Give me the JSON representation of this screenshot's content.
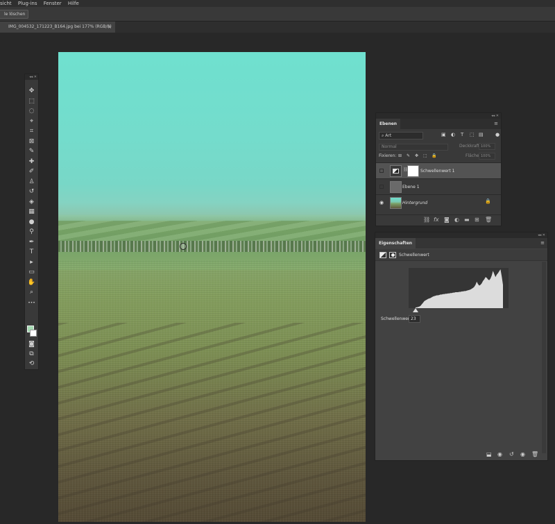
{
  "menubar": {
    "items": [
      "sicht",
      "Plug-ins",
      "Fenster",
      "Hilfe"
    ]
  },
  "options": {
    "clear_button": "le löschen"
  },
  "document": {
    "tab_title": "IMG_004532_171223_B164.jpg bei 177% (RGB/8)",
    "close_glyph": "×"
  },
  "toolbar": {
    "collapse": "◂◂ ✕",
    "tools": [
      {
        "name": "move-tool",
        "glyph": "✥"
      },
      {
        "name": "marquee-tool",
        "glyph": "⬚"
      },
      {
        "name": "lasso-tool",
        "glyph": "◌"
      },
      {
        "name": "quick-select-tool",
        "glyph": "⌖"
      },
      {
        "name": "crop-tool",
        "glyph": "⌗"
      },
      {
        "name": "frame-tool",
        "glyph": "⊠"
      },
      {
        "name": "eyedropper-tool",
        "glyph": "✎"
      },
      {
        "name": "healing-brush-tool",
        "glyph": "✚"
      },
      {
        "name": "brush-tool",
        "glyph": "✐"
      },
      {
        "name": "clone-stamp-tool",
        "glyph": "♙"
      },
      {
        "name": "history-brush-tool",
        "glyph": "↺"
      },
      {
        "name": "eraser-tool",
        "glyph": "◈"
      },
      {
        "name": "gradient-tool",
        "glyph": "▦"
      },
      {
        "name": "blur-tool",
        "glyph": "●"
      },
      {
        "name": "dodge-tool",
        "glyph": "⚲"
      },
      {
        "name": "pen-tool",
        "glyph": "✒"
      },
      {
        "name": "type-tool",
        "glyph": "T"
      },
      {
        "name": "path-select-tool",
        "glyph": "▸"
      },
      {
        "name": "shape-tool",
        "glyph": "▭"
      },
      {
        "name": "hand-tool",
        "glyph": "✋"
      },
      {
        "name": "zoom-tool",
        "glyph": "⌕"
      },
      {
        "name": "more-tools",
        "glyph": "•••"
      }
    ],
    "bottom_tools": [
      {
        "name": "quick-mask-icon",
        "glyph": "◙"
      },
      {
        "name": "screen-mode-icon",
        "glyph": "⧉"
      },
      {
        "name": "share-icon",
        "glyph": "⟲"
      }
    ],
    "foreground_color": "#a6dcb4",
    "background_color": "#ffffff"
  },
  "layers_panel": {
    "collapse": "◂◂ ✕",
    "tab": "Ebenen",
    "menu_glyph": "≡",
    "kind_filter": "Art",
    "blend_mode": "Normal",
    "opacity_label": "Deckkraft:",
    "opacity_value": "100%",
    "lock_label": "Fixieren:",
    "fill_label": "Fläche:",
    "fill_value": "100%",
    "layers": [
      {
        "name": "Schwellenwert 1",
        "visible": false,
        "selected": true
      },
      {
        "name": "Ebene 1",
        "visible": false,
        "selected": false
      },
      {
        "name": "Hintergrund",
        "visible": true,
        "selected": false,
        "locked": true
      }
    ],
    "eye_glyph": "👁",
    "lock_glyph": "🔒"
  },
  "properties_panel": {
    "collapse": "◂◂ ✕",
    "tab": "Eigenschaften",
    "menu_glyph": "≡",
    "adjustment_name": "Schwellenwert",
    "threshold_label": "Schwellenwert:",
    "threshold_value": "23",
    "histogram": [
      2,
      2,
      3,
      4,
      6,
      10,
      14,
      18,
      20,
      22,
      24,
      25,
      26,
      28,
      30,
      31,
      32,
      33,
      33,
      34,
      35,
      35,
      36,
      36,
      37,
      37,
      38,
      38,
      39,
      39,
      40,
      40,
      41,
      41,
      41,
      42,
      42,
      43,
      43,
      44,
      44,
      45,
      46,
      47,
      48,
      50,
      52,
      55,
      60,
      68,
      62,
      58,
      60,
      64,
      70,
      74,
      80,
      78,
      74,
      72,
      76,
      84,
      96,
      88,
      80,
      86,
      90,
      95,
      100,
      82,
      60
    ]
  }
}
